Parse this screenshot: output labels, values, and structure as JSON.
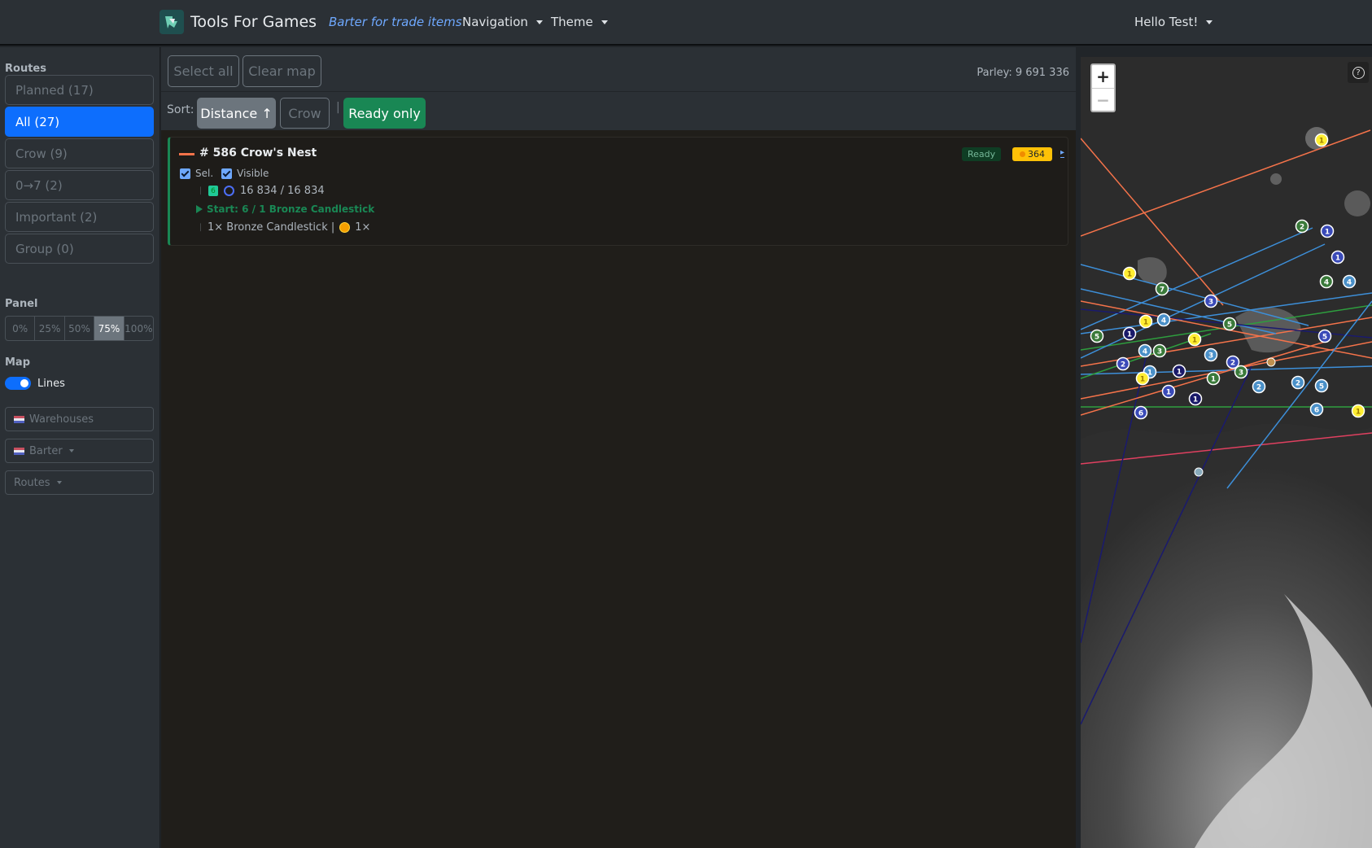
{
  "navbar": {
    "brand": "Tools For Games",
    "tagline": "Barter for trade items",
    "navigation": "Navigation",
    "theme": "Theme",
    "user": "Hello Test!"
  },
  "sidebar": {
    "routes_heading": "Routes",
    "route_filters": [
      {
        "label": "Planned (17)",
        "active": false
      },
      {
        "label": "All (27)",
        "active": true
      },
      {
        "label": "Crow (9)",
        "active": false
      },
      {
        "label": "0→7 (2)",
        "active": false
      },
      {
        "label": "Important (2)",
        "active": false
      },
      {
        "label": "Group (0)",
        "active": false
      }
    ],
    "panel_heading": "Panel",
    "panel_options": [
      "0%",
      "25%",
      "50%",
      "75%",
      "100%"
    ],
    "panel_selected": "75%",
    "map_heading": "Map",
    "lines_label": "Lines",
    "warehouses_label": "Warehouses",
    "barter_label": "Barter",
    "routes_label": "Routes"
  },
  "toolbar": {
    "select_all": "Select all",
    "clear_map": "Clear map",
    "parley": "Parley: 9 691 336"
  },
  "sortbar": {
    "label": "Sort:",
    "distance": "Distance ↑",
    "crow": "Crow",
    "separator": "|",
    "ready_only": "Ready only"
  },
  "route_card": {
    "title": "# 586 Crow's Nest",
    "ready_badge": "Ready",
    "coin_value": "364",
    "play": "▸",
    "sel_label": "Sel.",
    "visible_label": "Visible",
    "level": "6",
    "parley_cost": "16 834 / 16 834",
    "start": "Start: 6 / 1 Bronze Candlestick",
    "trade_item": "1× Bronze Candlestick |",
    "trade_return": "1×"
  },
  "map": {
    "zoom_in": "+",
    "zoom_out": "−",
    "help": "?",
    "line_colors": [
      "#f5734a",
      "#3d8fd9",
      "#2e9e3e",
      "#1a1a6e",
      "#e04060"
    ],
    "markers": [
      {
        "label": "1",
        "color": "yellow"
      },
      {
        "label": "2",
        "color": "green"
      },
      {
        "label": "1",
        "color": "blue"
      },
      {
        "label": "1",
        "color": "blue"
      },
      {
        "label": "4",
        "color": "green"
      },
      {
        "label": "4",
        "color": "lightblue"
      },
      {
        "label": "1",
        "color": "yellow"
      },
      {
        "label": "7",
        "color": "green"
      },
      {
        "label": "3",
        "color": "blue"
      },
      {
        "label": "5",
        "color": "green"
      },
      {
        "label": "1",
        "color": "yellow"
      },
      {
        "label": "4",
        "color": "lightblue"
      },
      {
        "label": "5",
        "color": "green"
      },
      {
        "label": "1",
        "color": "navy"
      },
      {
        "label": "1",
        "color": "yellow"
      },
      {
        "label": "5",
        "color": "blue"
      },
      {
        "label": "4",
        "color": "lightblue"
      },
      {
        "label": "3",
        "color": "green"
      },
      {
        "label": "3",
        "color": "lightblue"
      },
      {
        "label": "2",
        "color": "blue"
      },
      {
        "label": "2",
        "color": "blue"
      },
      {
        "label": "3",
        "color": "green"
      },
      {
        "label": "1",
        "color": "lightblue"
      },
      {
        "label": "1",
        "color": "navy"
      },
      {
        "label": "1",
        "color": "green"
      },
      {
        "label": "1",
        "color": "yellow"
      },
      {
        "label": "2",
        "color": "lightblue"
      },
      {
        "label": "2",
        "color": "lightblue"
      },
      {
        "label": "5",
        "color": "lightblue"
      },
      {
        "label": "1",
        "color": "blue"
      },
      {
        "label": "1",
        "color": "navy"
      },
      {
        "label": "6",
        "color": "lightblue"
      },
      {
        "label": "6",
        "color": "blue"
      },
      {
        "label": "1",
        "color": "yellow"
      }
    ]
  }
}
